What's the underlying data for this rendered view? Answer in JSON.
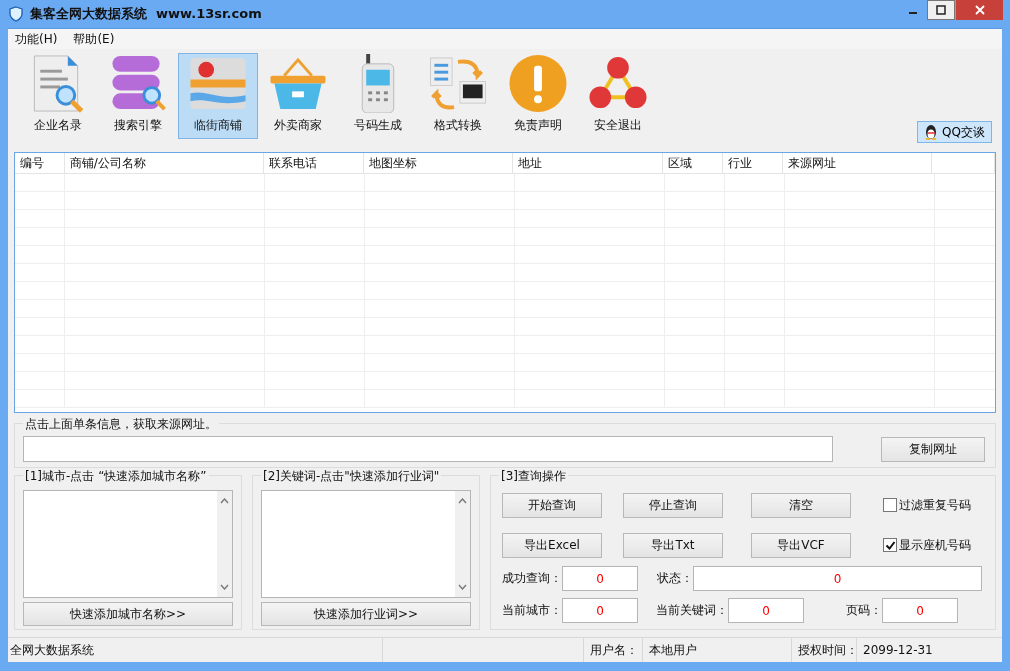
{
  "window": {
    "title": "集客全网大数据系统  www.13sr.com"
  },
  "menu": [
    "功能(H)",
    "帮助(E)"
  ],
  "toolbar": [
    {
      "label": "企业名录",
      "kind": "document",
      "selected": false
    },
    {
      "label": "搜索引擎",
      "kind": "database",
      "selected": false
    },
    {
      "label": "临街商铺",
      "kind": "map",
      "selected": true
    },
    {
      "label": "外卖商家",
      "kind": "basket",
      "selected": false
    },
    {
      "label": "号码生成",
      "kind": "phone",
      "selected": false
    },
    {
      "label": "格式转换",
      "kind": "convert",
      "selected": false
    },
    {
      "label": "免责声明",
      "kind": "warning",
      "selected": false
    },
    {
      "label": "安全退出",
      "kind": "network",
      "selected": false
    }
  ],
  "qq_button": "QQ交谈",
  "table": {
    "columns": [
      "编号",
      "商铺/公司名称",
      "联系电话",
      "地图坐标",
      "地址",
      "区域",
      "行业",
      "来源网址"
    ]
  },
  "url_group": {
    "title": "点击上面单条信息，获取来源网址。",
    "button": "复制网址"
  },
  "city_group": {
    "title": "[1]城市-点击 “快速添加城市名称”",
    "button": "快速添加城市名称>>"
  },
  "keyword_group": {
    "title": "[2]关键词-点击\"快速添加行业词\"",
    "button": "快速添加行业词>>"
  },
  "query_group": {
    "title": "[3]查询操作",
    "button_rows": [
      {
        "buttons": [
          "开始查询",
          "停止查询",
          "清空"
        ],
        "option": {
          "label": "过滤重复号码",
          "checked": false
        }
      },
      {
        "buttons": [
          "导出Excel",
          "导出Txt",
          "导出VCF"
        ],
        "option": {
          "label": "显示座机号码",
          "checked": true
        }
      }
    ],
    "field_rows": [
      {
        "fields": [
          {
            "label": "成功查询：",
            "value": "0"
          },
          {
            "label": "状态：",
            "value": "0"
          }
        ]
      },
      {
        "fields": [
          {
            "label": "当前城市：",
            "value": "0"
          },
          {
            "label": "当前关键词：",
            "value": "0"
          },
          {
            "label": "页码：",
            "value": "0"
          }
        ]
      }
    ]
  },
  "status_bar": {
    "text": "全网大数据系统",
    "user_label": "用户名：",
    "user": "本地用户",
    "license_label": "授权时间：",
    "license": "2099-12-31"
  }
}
